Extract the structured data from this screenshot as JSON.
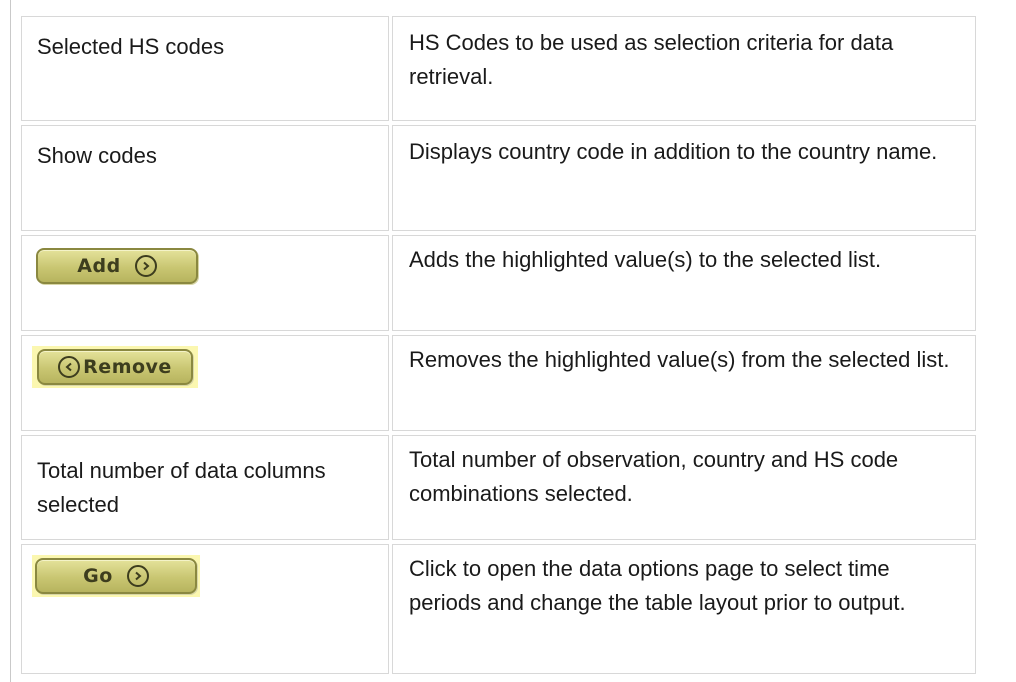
{
  "rows": [
    {
      "term": "Selected HS codes",
      "description": "HS Codes to be used as selection criteria for data retrieval."
    },
    {
      "term": "Show codes",
      "description": "Displays country code in addition to the country name."
    },
    {
      "button": "Add",
      "icon": "arrow-right-icon",
      "description": "Adds the highlighted value(s) to the selected list."
    },
    {
      "button": "Remove",
      "icon": "arrow-left-icon",
      "description": "Removes the highlighted value(s) from the selected list."
    },
    {
      "term": "Total number of data columns selected",
      "description": "Total number of observation, country and HS code combinations selected."
    },
    {
      "button": "Go",
      "icon": "arrow-right-icon",
      "description": "Click to open the data options page to select time periods and change the table layout prior to output."
    }
  ],
  "colors": {
    "button_fill": "#c9c672",
    "button_border": "#8a8840",
    "highlight": "#fbf7b0",
    "border": "#d8d8d8"
  }
}
